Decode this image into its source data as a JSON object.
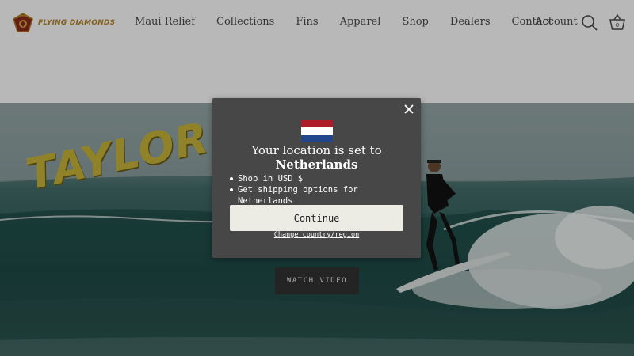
{
  "header": {
    "logo_text": "FLYING DIAMONDS",
    "nav": [
      "Maui Relief",
      "Collections",
      "Fins",
      "Apparel",
      "Shop",
      "Dealers",
      "Contact"
    ],
    "account_label": "Account",
    "cart_count": "0",
    "icons": {
      "search": "search-icon",
      "cart": "basket-icon"
    }
  },
  "hero": {
    "title_text": "TAYLOR JE",
    "watch_label": "WATCH VIDEO"
  },
  "modal": {
    "flag_colors": [
      "#ae1c28",
      "#ffffff",
      "#21468b"
    ],
    "title": "Your location is set to",
    "country": "Netherlands",
    "bullets": [
      "Shop in USD $",
      "Get shipping options for Netherlands"
    ],
    "continue_label": "Continue",
    "change_link": "Change country/region"
  }
}
